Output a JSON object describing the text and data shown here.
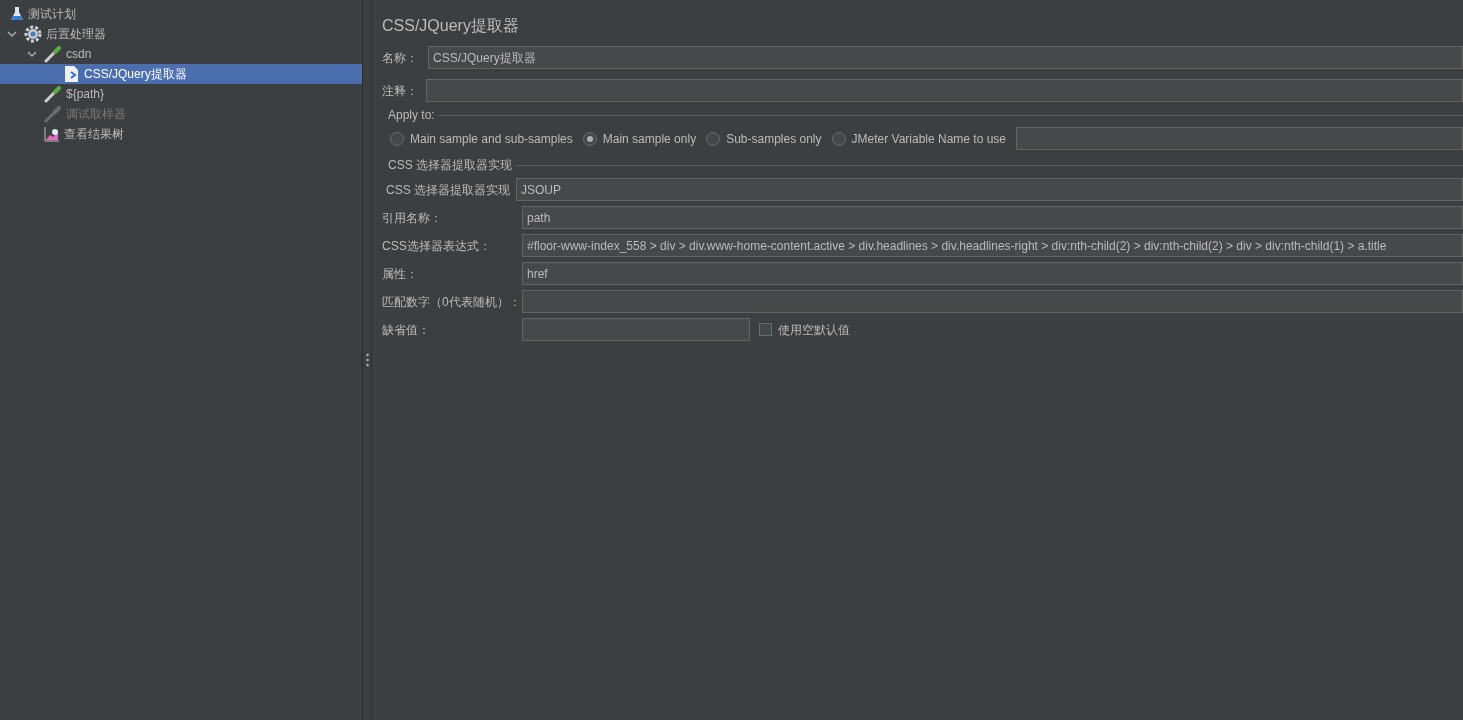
{
  "tree": [
    {
      "label": "测试计划",
      "kind": "flask",
      "selected": false,
      "disabled": false,
      "children": [
        {
          "label": "后置处理器",
          "kind": "gear",
          "selected": false,
          "disabled": false,
          "expanded": true,
          "children": [
            {
              "label": "csdn",
              "kind": "pipette",
              "selected": false,
              "disabled": false,
              "expanded": true,
              "children": [
                {
                  "label": "CSS/JQuery提取器",
                  "kind": "document",
                  "selected": true,
                  "disabled": false
                }
              ]
            },
            {
              "label": "${path}",
              "kind": "pipette",
              "selected": false,
              "disabled": false
            },
            {
              "label": "调试取样器",
              "kind": "pipette",
              "selected": false,
              "disabled": true
            },
            {
              "label": "查看结果树",
              "kind": "chart",
              "selected": false,
              "disabled": false
            }
          ]
        }
      ]
    }
  ],
  "panel": {
    "title": "CSS/JQuery提取器",
    "name": {
      "label": "名称：",
      "value": "CSS/JQuery提取器"
    },
    "comment": {
      "label": "注释："
    },
    "apply_to": {
      "legend": "Apply to:",
      "options": [
        {
          "label": "Main sample and sub-samples",
          "selected": false
        },
        {
          "label": "Main sample only",
          "selected": true
        },
        {
          "label": "Sub-samples only",
          "selected": false
        },
        {
          "label": "JMeter Variable Name to use",
          "selected": false
        }
      ]
    },
    "impl_section": {
      "legend": "CSS 选择器提取器实现",
      "label": "CSS 选择器提取器实现",
      "value": "JSOUP"
    },
    "fields": [
      {
        "label": "引用名称：",
        "value": "path"
      },
      {
        "label": "CSS选择器表达式：",
        "value": "#floor-www-index_558 > div > div.www-home-content.active > div.headlines > div.headlines-right > div:nth-child(2) > div:nth-child(2) > div > div:nth-child(1) > a.title"
      },
      {
        "label": "属性：",
        "value": "href"
      },
      {
        "label": "匹配数字（0代表随机）："
      }
    ],
    "default": {
      "label": "缺省值：",
      "checkbox": {
        "label": "使用空默认值",
        "checked": false
      }
    }
  }
}
